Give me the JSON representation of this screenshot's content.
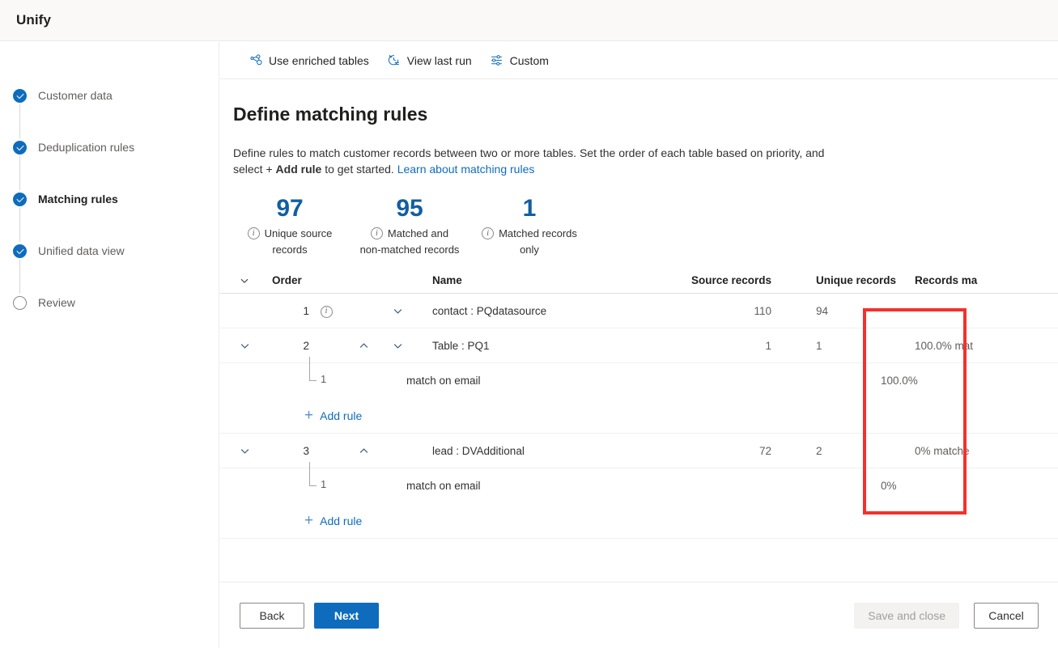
{
  "app": {
    "title": "Unify"
  },
  "sidebar": {
    "steps": [
      {
        "label": "Customer data",
        "state": "done",
        "current": false
      },
      {
        "label": "Deduplication rules",
        "state": "done",
        "current": false
      },
      {
        "label": "Matching rules",
        "state": "done",
        "current": true
      },
      {
        "label": "Unified data view",
        "state": "done",
        "current": false
      },
      {
        "label": "Review",
        "state": "todo",
        "current": false
      }
    ]
  },
  "commandbar": {
    "items": [
      {
        "label": "Use enriched tables",
        "icon": "enriched-tables-icon"
      },
      {
        "label": "View last run",
        "icon": "history-icon"
      },
      {
        "label": "Custom",
        "icon": "settings-sliders-icon"
      }
    ]
  },
  "page": {
    "title": "Define matching rules",
    "desc_part1": "Define rules to match customer records between two or more tables. Set the order of each table based on priority, and select + ",
    "desc_bold": "Add rule",
    "desc_part2": " to get started. ",
    "desc_link": "Learn about matching rules"
  },
  "stats": [
    {
      "value": "97",
      "line1": "Unique source",
      "line2": "records"
    },
    {
      "value": "95",
      "line1": "Matched and",
      "line2": "non-matched records"
    },
    {
      "value": "1",
      "line1": "Matched records",
      "line2": "only"
    }
  ],
  "table": {
    "headers": {
      "order": "Order",
      "name": "Name",
      "source_records": "Source records",
      "unique_records": "Unique records",
      "records_matched": "Records ma"
    },
    "add_rule_label": "Add rule",
    "rows": [
      {
        "type": "table",
        "order": "1",
        "name": "contact : PQdatasource",
        "source_records": "110",
        "unique_records": "94",
        "records_matched": "",
        "has_info": true,
        "has_left_chevron": false,
        "has_up": false,
        "has_down": true
      },
      {
        "type": "table",
        "order": "2",
        "name": "Table : PQ1",
        "source_records": "1",
        "unique_records": "1",
        "records_matched": "100.0% mat",
        "has_info": false,
        "has_left_chevron": true,
        "has_up": true,
        "has_down": true,
        "rules": [
          {
            "index": "1",
            "name": "match on email",
            "records_matched": "100.0%"
          }
        ]
      },
      {
        "type": "table",
        "order": "3",
        "name": "lead : DVAdditional",
        "source_records": "72",
        "unique_records": "2",
        "records_matched": "0% matche",
        "has_info": false,
        "has_left_chevron": true,
        "has_up": true,
        "has_down": false,
        "rules": [
          {
            "index": "1",
            "name": "match on email",
            "records_matched": "0%"
          }
        ]
      }
    ]
  },
  "footer": {
    "back": "Back",
    "next": "Next",
    "save_and_close": "Save and close",
    "cancel": "Cancel"
  },
  "colors": {
    "accent": "#0f6cbd",
    "stat_number": "#115ea3",
    "annotation": "#f3312c"
  }
}
